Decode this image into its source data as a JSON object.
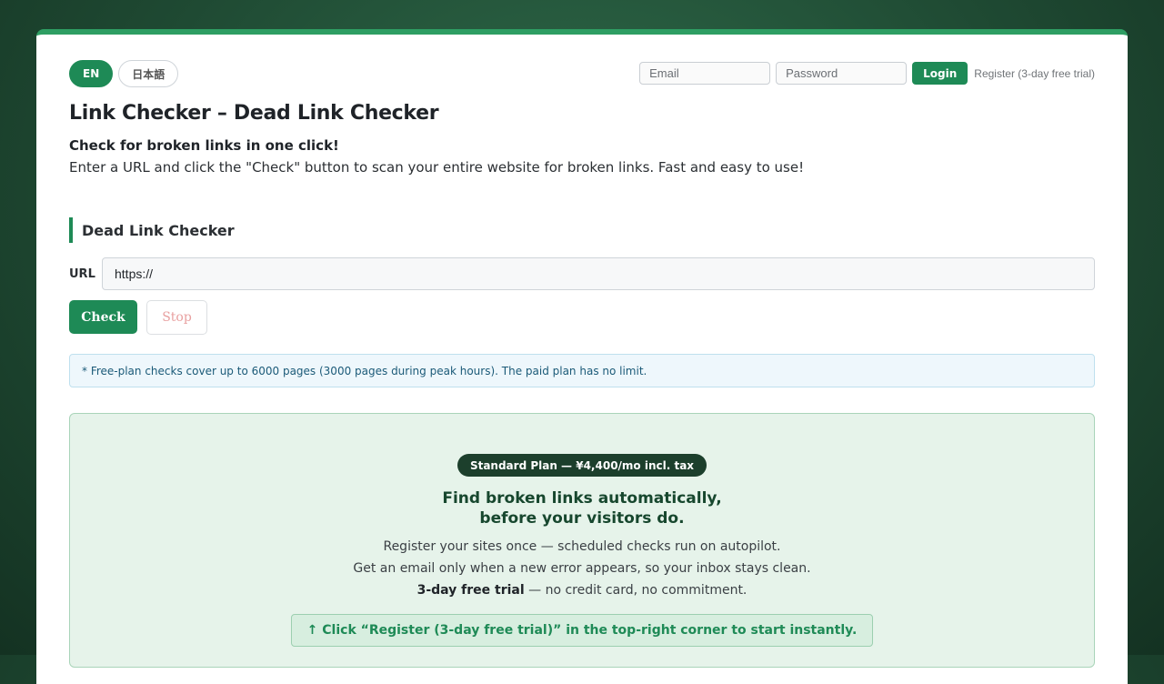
{
  "lang": {
    "en_label": "EN",
    "ja_label": "日本語"
  },
  "auth": {
    "email_placeholder": "Email",
    "password_placeholder": "Password",
    "login_label": "Login",
    "register_label": "Register (3-day free trial)"
  },
  "header": {
    "title": "Link Checker – Dead Link Checker",
    "tagline": "Check for broken links in one click!",
    "intro": "Enter a URL and click the \"Check\" button to scan your entire website for broken links. Fast and easy to use!"
  },
  "checker": {
    "section_title": "Dead Link Checker",
    "url_label": "URL",
    "url_value": "https://",
    "check_label": "Check",
    "stop_label": "Stop",
    "notice": "* Free-plan checks cover up to 6000 pages (3000 pages during peak hours). The paid plan has no limit."
  },
  "promo": {
    "plan_badge": "Standard Plan — ¥4,400/mo incl. tax",
    "headline_line1": "Find broken links automatically,",
    "headline_line2": "before your visitors do.",
    "line1": "Register your sites once — scheduled checks run on autopilot.",
    "line2": "Get an email only when a new error appears, so your inbox stays clean.",
    "trial_bold": "3-day free trial",
    "trial_rest": " — no credit card, no commitment.",
    "cta": "↑ Click “Register (3-day free trial)” in the top-right corner to start instantly."
  },
  "colors": {
    "accent": "#1e8a56",
    "promo_bg": "#e6f3ea",
    "notice_bg": "#eef7fc",
    "stop_text": "#e8a0a0"
  }
}
